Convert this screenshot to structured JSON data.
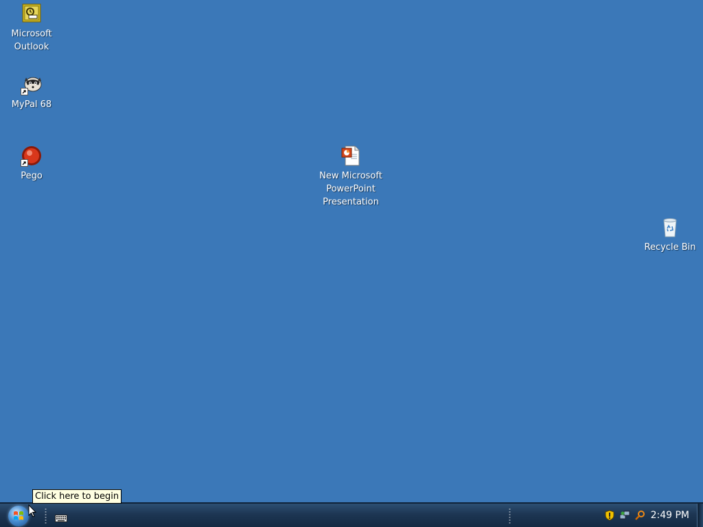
{
  "desktop": {
    "background_color": "#3b78b8",
    "icons": [
      {
        "label": "Microsoft\nOutlook",
        "icon": "outlook-icon"
      },
      {
        "label": "MyPal 68",
        "icon": "mypal-icon"
      },
      {
        "label": "Pego",
        "icon": "pego-icon"
      },
      {
        "label": "New Microsoft\nPowerPoint\nPresentation",
        "icon": "powerpoint-file-icon"
      },
      {
        "label": "Recycle Bin",
        "icon": "recycle-bin-icon"
      }
    ]
  },
  "taskbar": {
    "start_button": {
      "icon": "start-orb-icon"
    },
    "quick_launch": [
      {
        "icon": "keyboard-icon"
      }
    ],
    "tray": {
      "icons": [
        "security-shield-icon",
        "network-icon",
        "search-magnifier-icon"
      ],
      "clock": "2:49 PM"
    }
  },
  "tooltip": {
    "text": "Click here to begin"
  }
}
